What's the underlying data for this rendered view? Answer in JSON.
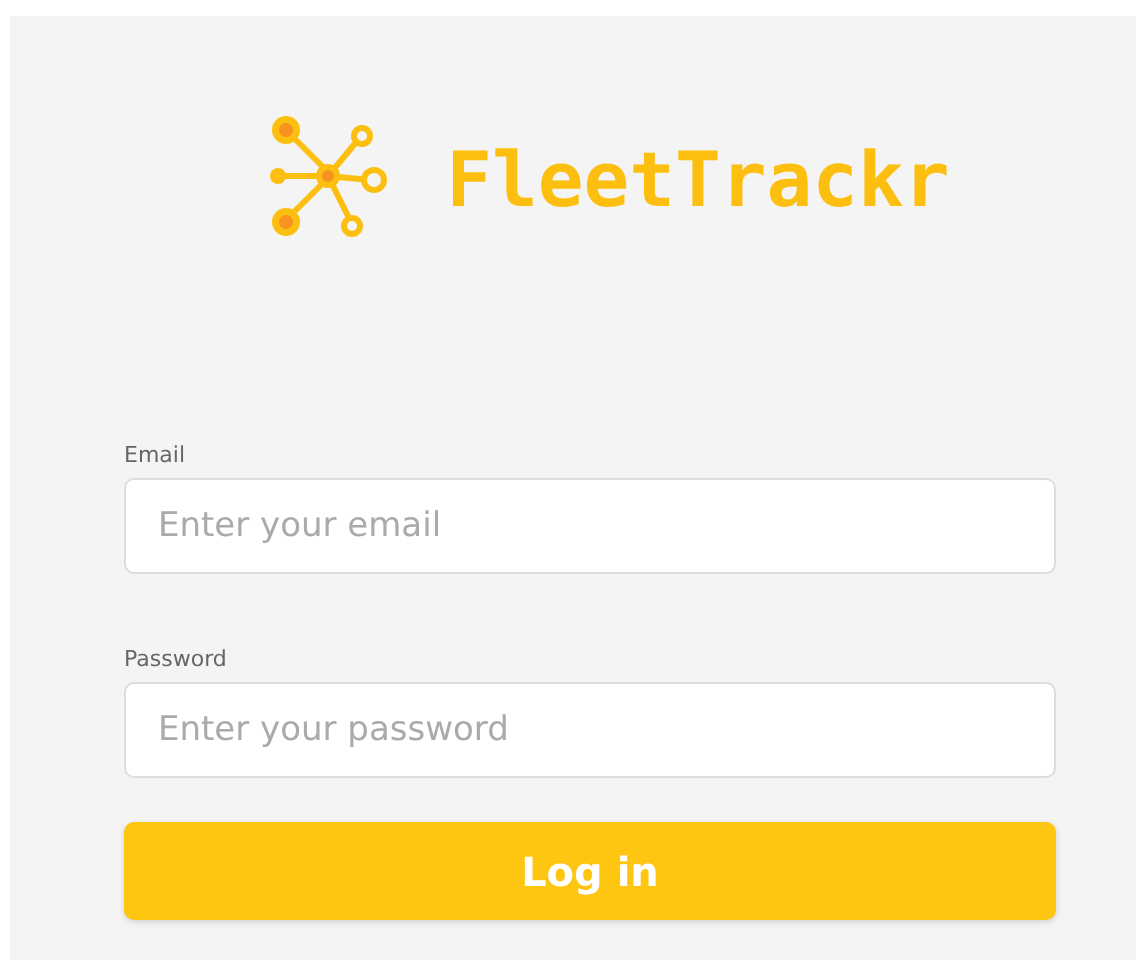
{
  "brand": {
    "name": "FleetTrackr"
  },
  "fields": [
    {
      "label": "Email",
      "placeholder": "Enter your email"
    },
    {
      "label": "Password",
      "placeholder": "Enter your password"
    }
  ],
  "buttons": [
    "Log in"
  ]
}
